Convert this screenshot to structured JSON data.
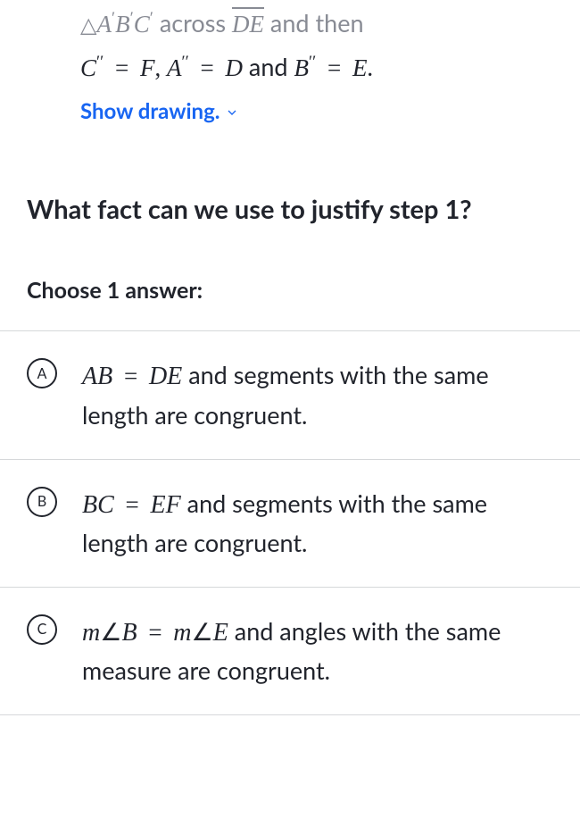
{
  "top": {
    "line1_pre_triangle": "△",
    "line1_math1": "A′B′C′",
    "line1_across": " across ",
    "line1_math2": "DE",
    "line1_andthen": " and then",
    "line2_c": "C″",
    "line2_eq1": " = ",
    "line2_f": "F",
    "line2_comma": ", ",
    "line2_a": "A″",
    "line2_eq2": " = ",
    "line2_d": "D",
    "line2_and": " and ",
    "line2_b": "B″",
    "line2_eq3": " = ",
    "line2_e": "E",
    "line2_period": ".",
    "show_drawing": "Show drawing."
  },
  "question": "What fact can we use to justify step 1?",
  "choose": "Choose 1 answer:",
  "choices": {
    "a": {
      "marker": "A",
      "math_lhs": "AB",
      "eq": " = ",
      "math_rhs": "DE",
      "rest": " and segments with the same length are congruent."
    },
    "b": {
      "marker": "B",
      "math_lhs": "BC",
      "eq": " = ",
      "math_rhs": "EF",
      "rest": " and segments with the same length are congruent."
    },
    "c": {
      "marker": "C",
      "m1": "m",
      "angle1": "∠",
      "b_char": "B",
      "eq": " = ",
      "m2": "m",
      "angle2": "∠",
      "e_char": "E",
      "rest": " and angles with the same measure are congruent."
    }
  }
}
